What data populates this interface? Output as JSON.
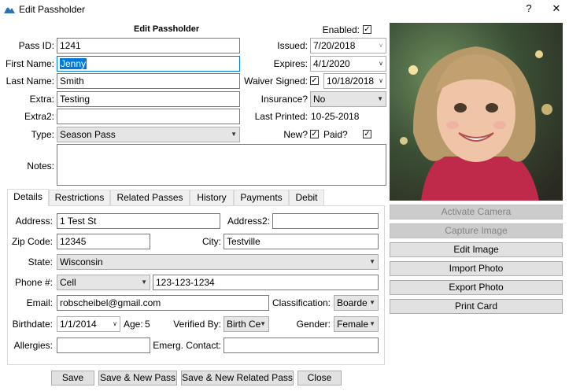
{
  "window": {
    "title": "Edit Passholder",
    "help_glyph": "?",
    "close_glyph": "✕"
  },
  "form": {
    "heading": "Edit Passholder",
    "enabled_label": "Enabled:",
    "pass_id_label": "Pass ID:",
    "pass_id": "1241",
    "first_name_label": "First Name:",
    "first_name": "Jenny",
    "last_name_label": "Last Name:",
    "last_name": "Smith",
    "extra_label": "Extra:",
    "extra": "Testing",
    "extra2_label": "Extra2:",
    "extra2": "",
    "type_label": "Type:",
    "type": "Season Pass",
    "notes_label": "Notes:",
    "notes": "",
    "issued_label": "Issued:",
    "issued": "7/20/2018",
    "expires_label": "Expires:",
    "expires": "4/1/2020",
    "waiver_label": "Waiver Signed:",
    "waiver_date": "10/18/2018",
    "insurance_label": "Insurance?",
    "insurance": "No",
    "last_printed_label": "Last Printed:",
    "last_printed": "10-25-2018",
    "new_label": "New?",
    "paid_label": "Paid?"
  },
  "tabs": [
    "Details",
    "Restrictions",
    "Related Passes",
    "History",
    "Payments",
    "Debit"
  ],
  "details": {
    "address_label": "Address:",
    "address": "1 Test St",
    "address2_label": "Address2:",
    "address2": "",
    "zip_label": "Zip Code:",
    "zip": "12345",
    "city_label": "City:",
    "city": "Testville",
    "state_label": "State:",
    "state": "Wisconsin",
    "phone_label": "Phone #:",
    "phone_type": "Cell",
    "phone": "123-123-1234",
    "email_label": "Email:",
    "email": "robscheibel@gmail.com",
    "classification_label": "Classification:",
    "classification": "Boarde",
    "birthdate_label": "Birthdate:",
    "birthdate": "1/1/2014",
    "age_label": "Age:",
    "age": "5",
    "verified_label": "Verified By:",
    "verified": "Birth Ce",
    "gender_label": "Gender:",
    "gender": "Female",
    "allergies_label": "Allergies:",
    "allergies": "",
    "emerg_label": "Emerg. Contact:",
    "emerg": ""
  },
  "side_buttons": {
    "activate_camera": "Activate Camera",
    "capture_image": "Capture Image",
    "edit_image": "Edit Image",
    "import_photo": "Import Photo",
    "export_photo": "Export Photo",
    "print_card": "Print Card"
  },
  "bottom_buttons": {
    "save": "Save",
    "save_new": "Save & New Pass",
    "save_new_related": "Save & New Related Pass",
    "close": "Close"
  }
}
